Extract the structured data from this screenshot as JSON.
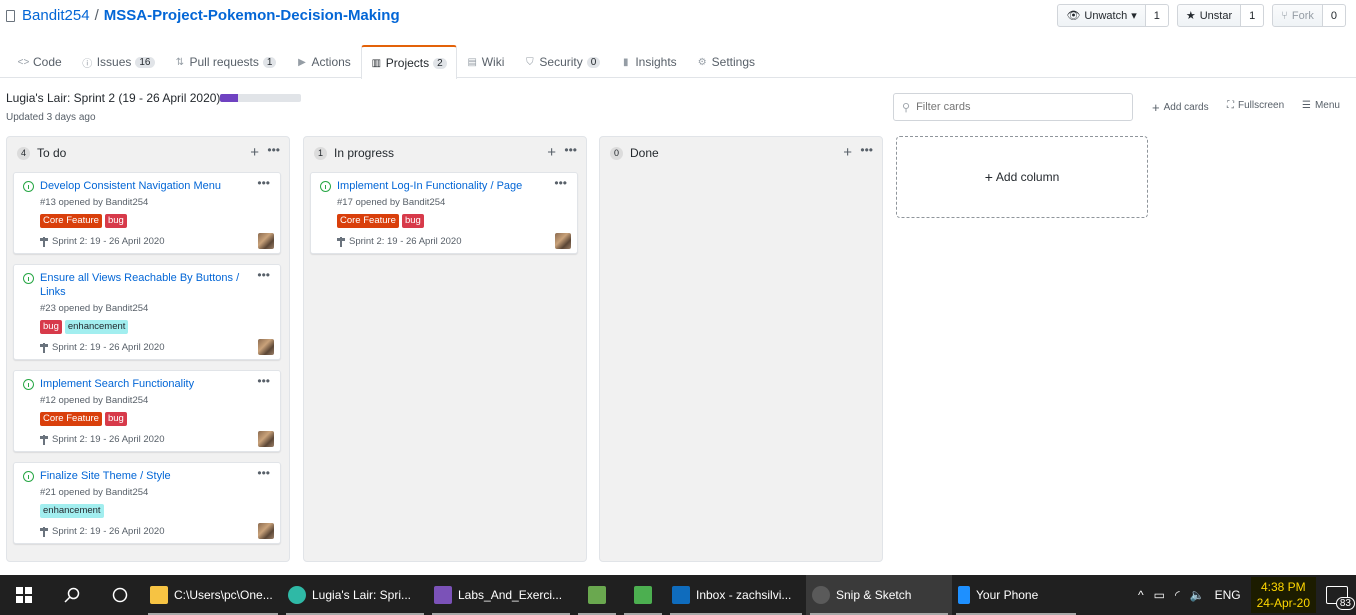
{
  "repo": {
    "owner": "Bandit254",
    "separator": "/",
    "name": "MSSA-Project-Pokemon-Decision-Making"
  },
  "actions": {
    "watch": {
      "label": "Unwatch",
      "count": "1"
    },
    "star": {
      "label": "Unstar",
      "count": "1"
    },
    "fork": {
      "label": "Fork",
      "count": "0"
    }
  },
  "tabs": [
    {
      "label": "Code",
      "icon": "code-icon",
      "badge": ""
    },
    {
      "label": "Issues",
      "icon": "issue-icon",
      "badge": "16"
    },
    {
      "label": "Pull requests",
      "icon": "pr-icon",
      "badge": "1"
    },
    {
      "label": "Actions",
      "icon": "play-icon",
      "badge": ""
    },
    {
      "label": "Projects",
      "icon": "project-icon",
      "badge": "2"
    },
    {
      "label": "Wiki",
      "icon": "book-icon",
      "badge": ""
    },
    {
      "label": "Security",
      "icon": "shield-icon",
      "badge": "0"
    },
    {
      "label": "Insights",
      "icon": "graph-icon",
      "badge": ""
    },
    {
      "label": "Settings",
      "icon": "gear-icon",
      "badge": ""
    }
  ],
  "project": {
    "title": "Lugia's Lair: Sprint 2 (19 - 26 April 2020)",
    "progress_fraction": 0.22,
    "progress_color": "#6f42c1",
    "updated": "Updated 3 days ago",
    "filter_placeholder": "Filter cards",
    "add_cards": "Add cards",
    "fullscreen": "Fullscreen",
    "menu": "Menu",
    "add_column": "Add column"
  },
  "columns": [
    {
      "name": "To do",
      "count": "4",
      "cards": [
        {
          "title": "Develop Consistent Navigation Menu",
          "meta": "#13 opened by Bandit254",
          "labels": [
            "Core Feature",
            "bug"
          ],
          "milestone": "Sprint 2: 19 - 26 April 2020"
        },
        {
          "title": "Ensure all Views Reachable By Buttons / Links",
          "meta": "#23 opened by Bandit254",
          "labels": [
            "bug",
            "enhancement"
          ],
          "milestone": "Sprint 2: 19 - 26 April 2020"
        },
        {
          "title": "Implement Search Functionality",
          "meta": "#12 opened by Bandit254",
          "labels": [
            "Core Feature",
            "bug"
          ],
          "milestone": "Sprint 2: 19 - 26 April 2020"
        },
        {
          "title": "Finalize Site Theme / Style",
          "meta": "#21 opened by Bandit254",
          "labels": [
            "enhancement"
          ],
          "milestone": "Sprint 2: 19 - 26 April 2020"
        }
      ]
    },
    {
      "name": "In progress",
      "count": "1",
      "cards": [
        {
          "title": "Implement Log-In Functionality / Page",
          "meta": "#17 opened by Bandit254",
          "labels": [
            "Core Feature",
            "bug"
          ],
          "milestone": "Sprint 2: 19 - 26 April 2020"
        }
      ]
    },
    {
      "name": "Done",
      "count": "0",
      "cards": []
    }
  ],
  "label_colors": {
    "Core Feature": "#d93f0b",
    "bug": "#d73a4a",
    "enhancement": "#a2eeef"
  },
  "taskbar": {
    "apps": [
      {
        "label": "C:\\Users\\pc\\One...",
        "icon": "folder-icon",
        "color": "#f6c343"
      },
      {
        "label": "Lugia's Lair: Spri...",
        "icon": "edge-icon",
        "color": "#2fb9a6"
      },
      {
        "label": "Labs_And_Exerci...",
        "icon": "visual-studio-icon",
        "color": "#7b52b8"
      },
      {
        "label": "",
        "icon": "xml-tool-icon",
        "color": "#6aa84f"
      },
      {
        "label": "",
        "icon": "notepad-icon",
        "color": "#4caf50"
      },
      {
        "label": "Inbox - zachsilvi...",
        "icon": "outlook-icon",
        "color": "#0f6cbd"
      },
      {
        "label": "Snip & Sketch",
        "icon": "snip-icon",
        "color": "#5a5a5a"
      },
      {
        "label": "Your Phone",
        "icon": "phone-icon",
        "color": "#1e90ff"
      }
    ],
    "language": "ENG",
    "time": "4:38 PM",
    "date": "24-Apr-20",
    "notifications": "83"
  }
}
